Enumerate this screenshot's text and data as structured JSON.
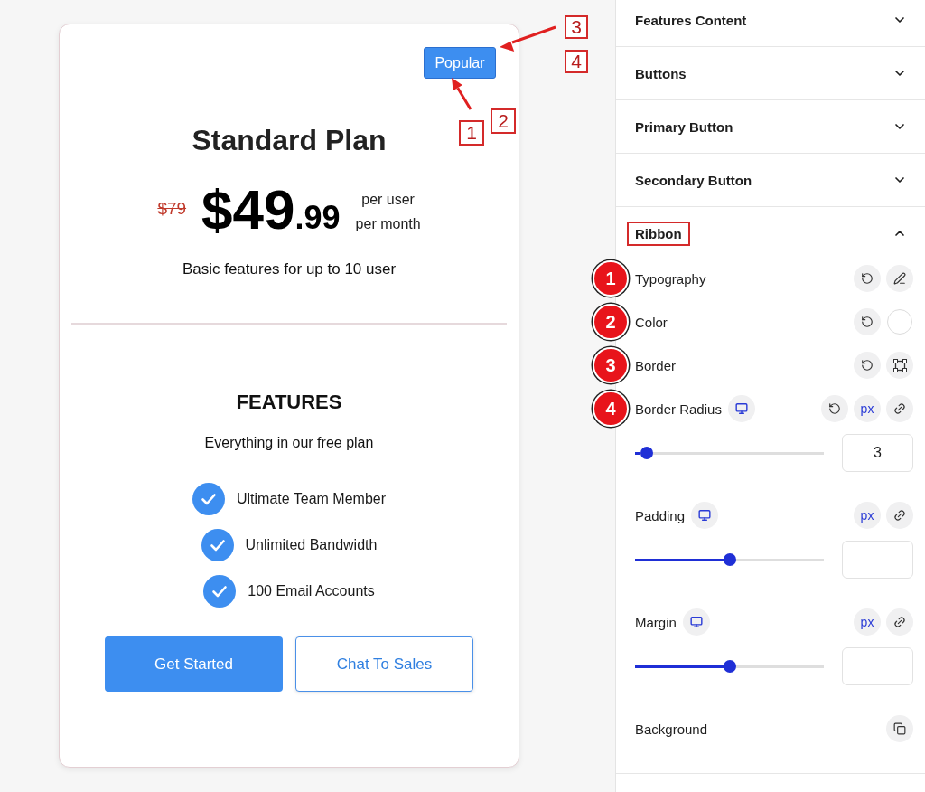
{
  "card": {
    "ribbon": {
      "label": "Popular",
      "callouts": [
        {
          "text": "3"
        },
        {
          "text": "4"
        },
        {
          "text": "1"
        },
        {
          "text": "2"
        }
      ]
    },
    "title": "Standard Plan",
    "price": {
      "old": "$79",
      "amount": "$49",
      "cents": ".99",
      "period_lines": [
        "per user",
        "per month"
      ]
    },
    "description": "Basic features for up to 10 user",
    "features_heading": "FEATURES",
    "features_subtitle": "Everything in our free plan",
    "features": [
      {
        "label": "Ultimate Team Member"
      },
      {
        "label": "Unlimited Bandwidth"
      },
      {
        "label": "100 Email Accounts"
      }
    ],
    "buttons": [
      {
        "label": "Get Started",
        "kind": "primary"
      },
      {
        "label": "Chat To Sales",
        "kind": "secondary"
      }
    ]
  },
  "panel": {
    "sections": [
      {
        "title": "Features Content",
        "expanded": false,
        "highlighted": false
      },
      {
        "title": "Buttons",
        "expanded": false,
        "highlighted": false
      },
      {
        "title": "Primary Button",
        "expanded": false,
        "highlighted": false
      },
      {
        "title": "Secondary Button",
        "expanded": false,
        "highlighted": false
      },
      {
        "title": "Ribbon",
        "expanded": true,
        "highlighted": true,
        "controls": [
          {
            "kind": "typography",
            "label": "Typography",
            "marker": "1",
            "resettable": true
          },
          {
            "kind": "color",
            "label": "Color",
            "marker": "2",
            "resettable": true,
            "color": "#ffffff"
          },
          {
            "kind": "border",
            "label": "Border",
            "marker": "3",
            "resettable": true
          },
          {
            "kind": "dimension",
            "label": "Border Radius",
            "marker": "4",
            "resettable": true,
            "unit": "px",
            "level": 0.03,
            "value": "3"
          },
          {
            "kind": "dimension",
            "label": "Padding",
            "resettable": false,
            "unit": "px",
            "level": 0.5
          },
          {
            "kind": "dimension",
            "label": "Margin",
            "resettable": false,
            "unit": "px",
            "level": 0.5
          },
          {
            "kind": "background",
            "label": "Background",
            "resettable": false
          }
        ]
      }
    ]
  }
}
